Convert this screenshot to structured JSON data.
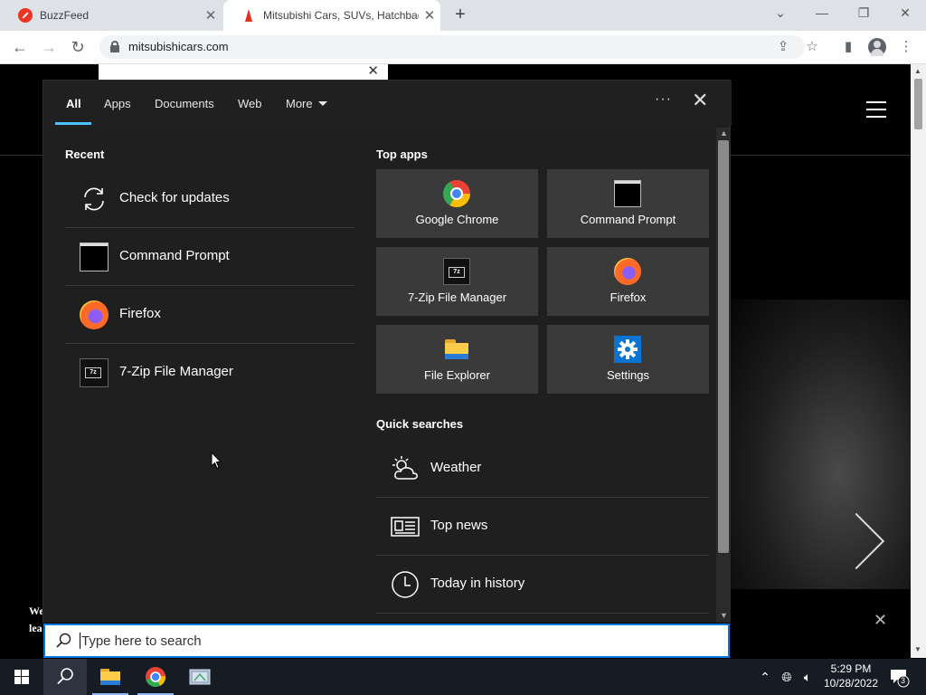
{
  "browser": {
    "tabs": [
      {
        "title": "BuzzFeed"
      },
      {
        "title": "Mitsubishi Cars, SUVs, Hatchback"
      }
    ],
    "url": "mitsubishicars.com"
  },
  "search_panel": {
    "tabs": [
      "All",
      "Apps",
      "Documents",
      "Web",
      "More"
    ],
    "active_tab": "All",
    "recent_title": "Recent",
    "recent": [
      {
        "label": "Check for updates",
        "icon": "refresh-icon"
      },
      {
        "label": "Command Prompt",
        "icon": "command-prompt-icon"
      },
      {
        "label": "Firefox",
        "icon": "firefox-icon"
      },
      {
        "label": "7-Zip File Manager",
        "icon": "7zip-icon"
      }
    ],
    "top_apps_title": "Top apps",
    "top_apps": [
      {
        "label": "Google Chrome",
        "icon": "chrome-icon"
      },
      {
        "label": "Command Prompt",
        "icon": "command-prompt-icon"
      },
      {
        "label": "7-Zip File Manager",
        "icon": "7zip-icon"
      },
      {
        "label": "Firefox",
        "icon": "firefox-icon"
      },
      {
        "label": "File Explorer",
        "icon": "file-explorer-icon"
      },
      {
        "label": "Settings",
        "icon": "settings-icon"
      }
    ],
    "quick_searches_title": "Quick searches",
    "quick_searches": [
      {
        "label": "Weather",
        "icon": "weather-icon"
      },
      {
        "label": "Top news",
        "icon": "news-icon"
      },
      {
        "label": "Today in history",
        "icon": "clock-icon"
      }
    ],
    "sevenzip_glyph": "7z",
    "search": {
      "placeholder": "Type here to search",
      "value": ""
    }
  },
  "site": {
    "text_lines": [
      "We",
      "lea"
    ]
  },
  "taskbar": {
    "time": "5:29 PM",
    "date": "10/28/2022",
    "notification_count": "3"
  },
  "colors": {
    "accent": "#4cc2ff",
    "search_border": "#0078d7",
    "panel_bg": "#1f1f1f",
    "tile_bg": "#3a3a3a"
  }
}
